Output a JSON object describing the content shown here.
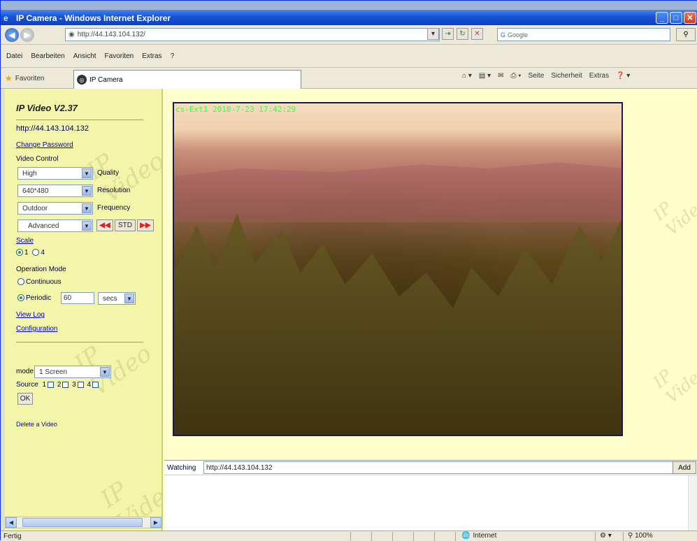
{
  "window": {
    "title": "IP Camera - Windows Internet Explorer"
  },
  "address": {
    "url": "http://44.143.104.132/"
  },
  "search": {
    "engine": "Google"
  },
  "menu": [
    "Datei",
    "Bearbeiten",
    "Ansicht",
    "Favoriten",
    "Extras",
    "?"
  ],
  "tabbar": {
    "favorites": "Favoriten",
    "tab_label": "IP Camera",
    "commands": [
      "Seite",
      "Sicherheit",
      "Extras"
    ]
  },
  "sidebar": {
    "title": "IP Video V2.37",
    "url": "http://44.143.104.132",
    "change_password": "Change Password",
    "video_control": "Video Control",
    "quality": {
      "value": "High",
      "label": "Quality"
    },
    "resolution": {
      "value": "640*480",
      "label": "Resolution"
    },
    "frequency": {
      "value": "Outdoor",
      "label": "Frequency"
    },
    "advanced": {
      "value": "Advanced",
      "std_label": "STD"
    },
    "scale": {
      "label": "Scale",
      "options": [
        "1",
        "4"
      ]
    },
    "operation_mode": {
      "label": "Operation Mode",
      "continuous": "Continuous",
      "periodic": "Periodic",
      "periodic_value": "60",
      "unit": "secs"
    },
    "view_log": "View Log",
    "configuration": "Configuration",
    "mode": {
      "label": "mode",
      "value": "1 Screen"
    },
    "source": {
      "label": "Source",
      "items": [
        "1",
        "2",
        "3",
        "4"
      ]
    },
    "ok_label": "OK",
    "delete_video": "Delete a Video",
    "watermark": "IP Video"
  },
  "video": {
    "timestamp": "cs-Ext1 2010-7-23 17:42:29"
  },
  "watching": {
    "label": "Watching",
    "url": "http://44.143.104.132",
    "add_label": "Add"
  },
  "status": {
    "left": "Fertig",
    "zone": "Internet",
    "zoom": "100%"
  }
}
